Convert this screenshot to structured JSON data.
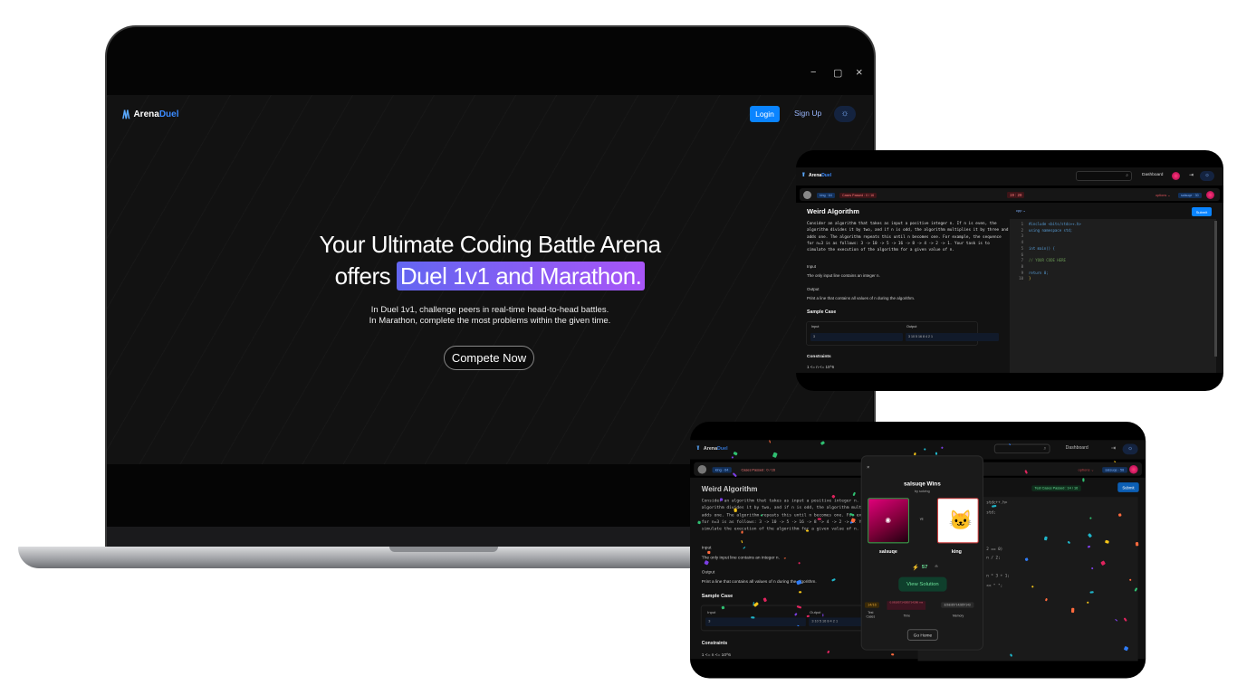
{
  "laptop": {
    "window_controls": {
      "minimize": "−",
      "maximize": "▢",
      "close": "×"
    },
    "brand": {
      "prefix": "Arena",
      "suffix": "Duel",
      "logo_icon": "mountain-peaks-icon"
    },
    "nav": {
      "login": "Login",
      "signup": "Sign Up",
      "theme_icon": "sun-icon"
    },
    "hero": {
      "line1": "Your Ultimate Coding Battle Arena",
      "line2_prefix": "offers ",
      "line2_highlight": "Duel 1v1 and Marathon.",
      "sub1": "In Duel 1v1, challenge peers in real-time head-to-head battles.",
      "sub2": "In Marathon, complete the most problems within the given time.",
      "cta": "Compete Now"
    },
    "colors": {
      "accent": "#0a84ff",
      "highlight_start": "#6366f1",
      "highlight_end": "#a855f7"
    }
  },
  "editor_screen": {
    "brand": {
      "prefix": "Arena",
      "suffix": "Duel"
    },
    "nav": {
      "dashboard": "Dashboard",
      "search_icon": "search-icon",
      "logout_icon": "logout-icon",
      "theme_icon": "sun-icon"
    },
    "status": {
      "opponent": "king · 64",
      "cases": "Cases Passed : 0 / 16",
      "timer": "19 : 28",
      "options": "options ⌄",
      "self": "salsuqe · 30"
    },
    "problem": {
      "title": "Weird Algorithm",
      "description": "Consider an algorithm that takes as input a positive integer n. If n is even, the algorithm divides it by two, and if n is odd, the algorithm multiplies it by three and adds one. The algorithm repeats this until n becomes one. For example, the sequence for n=3 is as follows: 3 -> 10 -> 5 -> 16 -> 8 -> 4 -> 2 -> 1. Your task is to simulate the execution of the algorithm for a given value of n.",
      "input_label": "Input",
      "input_text": "The only input line contains an integer n.",
      "output_label": "Output",
      "output_text": "Print a line that contains all values of n during the algorithm.",
      "sample_label": "Sample Case",
      "sample_input_header": "Input",
      "sample_output_header": "Output",
      "sample_input": "3",
      "sample_output": "3 10 5 16 8 4 2 1",
      "constraints_label": "Constraints",
      "constraints": "1 <= n <= 10^6"
    },
    "language": "cpp ⌄",
    "submit": "Submit",
    "code": [
      "#include <bits/stdc++.h>",
      "using namespace std;",
      "",
      "",
      "int main() {",
      "",
      "    // YOUR CODE HERE",
      "",
      "    return 0;",
      "}"
    ]
  },
  "result_screen": {
    "brand": {
      "prefix": "Arena",
      "suffix": "Duel"
    },
    "nav": {
      "dashboard": "Dashboard"
    },
    "status": {
      "opponent": "king · 64",
      "cases": "Cases Passed : 0 / 16",
      "passed": "Test Cases Passed : 14 / 16",
      "options": "options ⌄",
      "self": "salsuqe · 58"
    },
    "submit": "Submit",
    "code_fragments": [
      "stdc++.h>",
      "std;",
      "2 == 0)",
      "n / 2;",
      "n * 3 + 1;",
      "<< \" \";"
    ],
    "modal": {
      "close": "×",
      "title": "salsuqe Wins",
      "subtitle": "by solving",
      "vs": "vs",
      "winner": "salsuqe",
      "loser": "king",
      "score": "57",
      "score_icon": "lightning-icon",
      "view_solution": "View Solution",
      "test_cases_value": "14/16",
      "test_cases_label": "Test Cases",
      "time_value": "0.08185714285714286 ms",
      "time_label": "Time",
      "memory_value": "3268.857142857143",
      "memory_label": "Memory",
      "go_home": "Go Home"
    }
  }
}
